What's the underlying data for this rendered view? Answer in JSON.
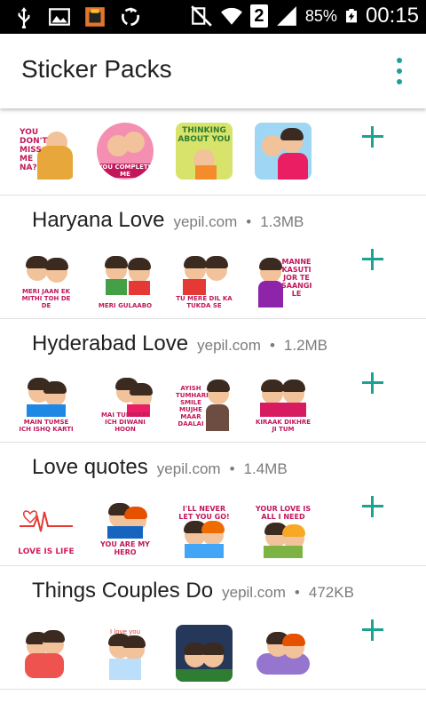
{
  "status_bar": {
    "icons": [
      "usb-icon",
      "image-icon",
      "app-notification-icon",
      "sync-icon",
      "mute-icon",
      "wifi-icon",
      "sim-icon",
      "signal-icon",
      "battery-charging-icon"
    ],
    "sim_number": "2",
    "battery": "85%",
    "time": "00:15"
  },
  "app_bar": {
    "title": "Sticker Packs",
    "overflow_icon": "more-vert-icon",
    "accent": "#1aa393"
  },
  "packs": [
    {
      "name": "",
      "publisher": "",
      "size": "",
      "stickers": [
        {
          "caption": "YOU DON'T MISS ME NA?"
        },
        {
          "caption": "YOU COMPLETE ME"
        },
        {
          "caption": "THINKING ABOUT YOU"
        },
        {
          "caption": ""
        }
      ]
    },
    {
      "name": "Haryana Love",
      "publisher": "yepil.com",
      "size": "1.3MB",
      "stickers": [
        {
          "caption": "MERI JAAN EK MITHI TOH DE DE"
        },
        {
          "caption": "MERI GULAABO"
        },
        {
          "caption": "TU MERE DIL KA TUKDA SE"
        },
        {
          "caption": "MANNE KASUTI JOR TE SAANGH LE"
        }
      ]
    },
    {
      "name": "Hyderabad Love",
      "publisher": "yepil.com",
      "size": "1.2MB",
      "stickers": [
        {
          "caption": "MAIN TUMSE ICH ISHQ KARTI"
        },
        {
          "caption": "MAI TUMHARI ICH DIWANI HOON"
        },
        {
          "caption": "AYISH TUMHARI SMILE MUJHE MAAR DAALAI"
        },
        {
          "caption": "KIRAAK DIKHRE JI TUM"
        }
      ]
    },
    {
      "name": "Love quotes",
      "publisher": "yepil.com",
      "size": "1.4MB",
      "stickers": [
        {
          "caption": "LOVE IS LIFE"
        },
        {
          "caption": "YOU ARE MY HERO"
        },
        {
          "caption": "I'LL NEVER LET YOU GO!"
        },
        {
          "caption": "YOUR LOVE IS ALL I NEED"
        }
      ]
    },
    {
      "name": "Things Couples Do",
      "publisher": "yepil.com",
      "size": "472KB",
      "stickers": [
        {
          "caption": ""
        },
        {
          "caption": "I love you"
        },
        {
          "caption": ""
        },
        {
          "caption": ""
        }
      ]
    }
  ]
}
